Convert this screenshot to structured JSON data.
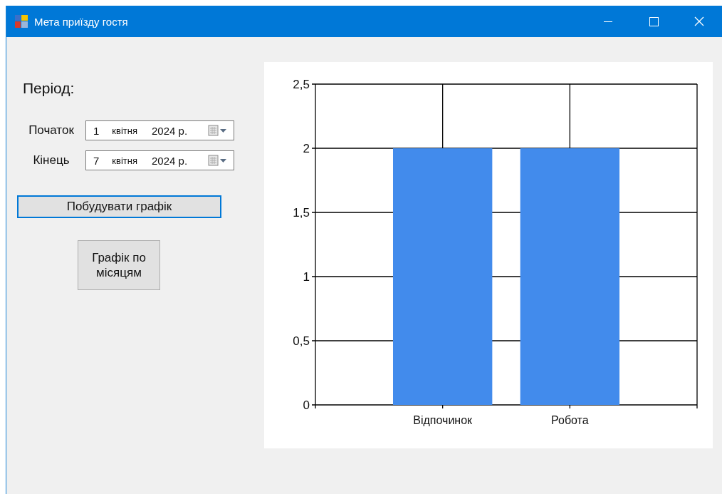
{
  "window": {
    "title": "Мета приїзду гостя"
  },
  "period_label": "Період:",
  "date_fields": [
    {
      "label": "Початок",
      "day": "1",
      "month": "квітня",
      "year": "2024 р."
    },
    {
      "label": "Кінець",
      "day": "7",
      "month": "квітня",
      "year": "2024 р."
    }
  ],
  "buttons": [
    {
      "label": "Побудувати графік",
      "focused": true,
      "kind": "wide"
    },
    {
      "label": "Графік по місяцям",
      "focused": false,
      "kind": "square"
    }
  ],
  "chart": {
    "chart_data": {
      "type": "bar",
      "categories": [
        "Відпочинок",
        "Робота"
      ],
      "series": [
        {
          "color": "#428bec",
          "values": [
            2,
            2
          ]
        }
      ],
      "ylim": [
        0,
        2.5
      ],
      "grid": true,
      "yticks": [
        0,
        {
          "value": 0.5,
          "label": "0,5"
        },
        1,
        {
          "value": 1.5,
          "label": "1,5"
        },
        2,
        {
          "value": 2.5,
          "label": "2,5"
        }
      ]
    }
  }
}
